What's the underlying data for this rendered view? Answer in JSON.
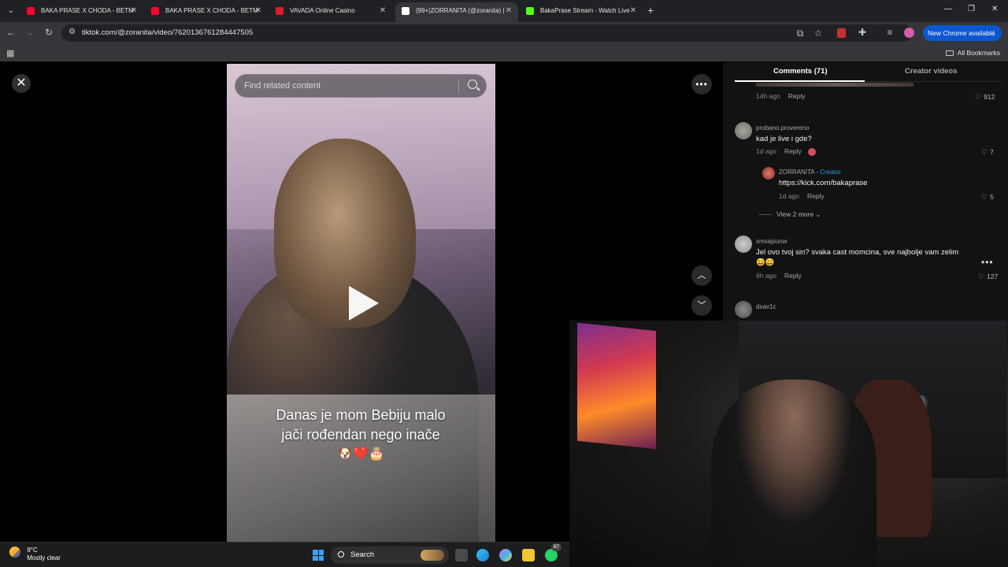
{
  "browser": {
    "tabs": [
      {
        "title": "BAKA PRASE X CHODA - BETM",
        "favicon_color": "#ff0033",
        "active": false
      },
      {
        "title": "BAKA PRASE X CHODA - BETM",
        "favicon_color": "#ff0033",
        "active": false
      },
      {
        "title": "VAVADA Online Casino",
        "favicon_color": "#d91e2a",
        "active": false
      },
      {
        "title": "(99+)ZORRANITA (@zoranita) |",
        "favicon_color": "#ffffff",
        "active": true
      },
      {
        "title": "BakaPrase Stream - Watch Live",
        "favicon_color": "#53fc18",
        "active": false
      }
    ],
    "url": "tiktok.com/@zoranita/video/7620136761284447505",
    "new_chrome_label": "New Chrome available",
    "all_bookmarks_label": "All Bookmarks"
  },
  "video": {
    "search_placeholder": "Find related content",
    "caption_line1": "Danas je mom Bebiju malo",
    "caption_line2": "jači rođendan nego inače",
    "caption_emojis": "🐶❤️🎂"
  },
  "comments_panel": {
    "tab_comments": "Comments (71)",
    "tab_creator_videos": "Creator videos",
    "comments": [
      {
        "time": "14h ago",
        "reply": "Reply",
        "likes": "912"
      },
      {
        "username": "probano.provereno",
        "text": "kad je live i gde?",
        "time": "1d ago",
        "reply": "Reply",
        "likes": "7"
      },
      {
        "username": "ZORRANITA",
        "creator_label": "Creator",
        "text": "https://kick.com/bakaprase",
        "time": "1d ago",
        "reply": "Reply",
        "likes": "5"
      },
      {
        "username": "xmsajsunw",
        "text": "Jel ovo tvoj sin? svaka cast momcina, sve najbolje vam zelim 😄😄",
        "time": "6h ago",
        "reply": "Reply",
        "likes": "127"
      },
      {
        "username": "dsav1c"
      }
    ],
    "view_more": "View 2 more"
  },
  "taskbar": {
    "temperature": "9°C",
    "weather_desc": "Mostly clear",
    "search_label": "Search",
    "whatsapp_badge": "87"
  },
  "colors": {
    "accent_blue": "#0b57d0",
    "creator_blue": "#25a4e0",
    "tiktok_bg": "#121212"
  }
}
